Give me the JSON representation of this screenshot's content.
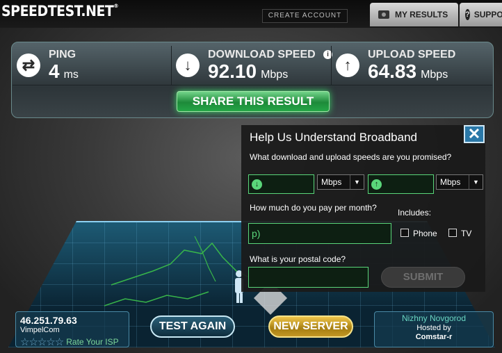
{
  "header": {
    "logo": "SPEEDTEST.NET",
    "logo_mark": "®",
    "create_account": "CREATE ACCOUNT",
    "my_results": "MY RESULTS",
    "support": "SUPPORT"
  },
  "metrics": {
    "ping": {
      "label": "PING",
      "value": "4",
      "unit": "ms"
    },
    "download": {
      "label": "DOWNLOAD SPEED",
      "value": "92.10",
      "unit": "Mbps"
    },
    "upload": {
      "label": "UPLOAD SPEED",
      "value": "64.83",
      "unit": "Mbps"
    }
  },
  "share_button": "SHARE THIS RESULT",
  "dialog": {
    "title": "Help Us Understand Broadband",
    "q_speeds": "What download and upload speeds are you promised?",
    "download_unit": "Mbps",
    "upload_unit": "Mbps",
    "q_pay": "How much do you pay per month?",
    "pay_value": "p)",
    "includes": "Includes:",
    "phone": "Phone",
    "tv": "TV",
    "q_postal": "What is your postal code?",
    "submit": "SUBMIT",
    "close": "✕"
  },
  "isp": {
    "ip": "46.251.79.63",
    "name": "VimpelCom",
    "rating": 0,
    "rate_label": "Rate Your ISP"
  },
  "buttons": {
    "test_again": "TEST AGAIN",
    "new_server": "NEW SERVER"
  },
  "server": {
    "city": "Nizhny Novgorod",
    "hosted_label": "Hosted by",
    "host": "Comstar-r"
  },
  "colors": {
    "accent_green": "#5ad67a",
    "accent_blue": "#2a78a8",
    "gold": "#f0c54a"
  }
}
